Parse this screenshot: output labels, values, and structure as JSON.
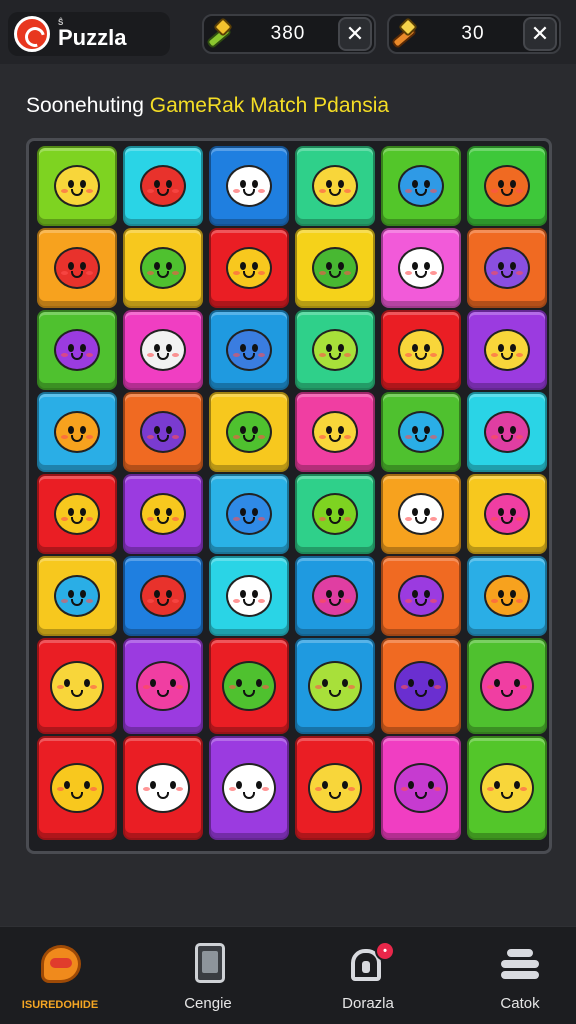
{
  "header": {
    "brand_small": "Ŝ",
    "brand_name": "Puzzla",
    "counters": [
      {
        "value": "380",
        "icon": "hammer-icon",
        "close": "✕"
      },
      {
        "value": "30",
        "icon": "rocket-icon",
        "close": "✕"
      }
    ]
  },
  "title": {
    "part1": "Soonehuting ",
    "part2": "GameRak Match Pdansia"
  },
  "board": {
    "rows": [
      [
        {
          "color": "#7ed321",
          "face": "#f8d63a",
          "icon": "cat-face-icon"
        },
        {
          "color": "#2ad4e6",
          "face": "#e8322c",
          "icon": "rocket-icon"
        },
        {
          "color": "#1f7fe0",
          "face": "#ffffff",
          "icon": "ghost-face-icon"
        },
        {
          "color": "#2fd08a",
          "face": "#f8d63a",
          "icon": "smile-bubble-icon"
        },
        {
          "color": "#53c62a",
          "face": "#2f9ae6",
          "icon": "blob-face-icon"
        },
        {
          "color": "#3ec83a",
          "face": "#f06a22",
          "icon": "chat-face-icon"
        }
      ],
      [
        {
          "color": "#f7a21e",
          "face": "#e8322c",
          "icon": "devil-face-icon"
        },
        {
          "color": "#f7c81e",
          "face": "#4fc12f",
          "icon": "blob-face-icon"
        },
        {
          "color": "#ea1e24",
          "face": "#f8c81e",
          "icon": "sun-face-icon"
        },
        {
          "color": "#f5d21a",
          "face": "#48b832",
          "icon": "blob-face-icon"
        },
        {
          "color": "#f25ad9",
          "face": "#ffffff",
          "icon": "star-face-icon"
        },
        {
          "color": "#f06a22",
          "face": "#8a4fe0",
          "icon": "chat-face-icon"
        }
      ],
      [
        {
          "color": "#4fc12f",
          "face": "#9b3be0",
          "icon": "chat-face-icon"
        },
        {
          "color": "#f03ec2",
          "face": "#f2f2f2",
          "icon": "sword-icon"
        },
        {
          "color": "#1f9ae0",
          "face": "#3a7de0",
          "icon": "planet-icon"
        },
        {
          "color": "#2fd08a",
          "face": "#a8e03a",
          "icon": "blob-face-icon"
        },
        {
          "color": "#ea1e24",
          "face": "#f8d63a",
          "icon": "chat-face-icon"
        },
        {
          "color": "#9b3be0",
          "face": "#f8d63a",
          "icon": "chat-face-icon"
        }
      ],
      [
        {
          "color": "#2aaee6",
          "face": "#f7a21e",
          "icon": "coin-icon"
        },
        {
          "color": "#f06a22",
          "face": "#7a3bd0",
          "icon": "box-icon"
        },
        {
          "color": "#f7c81e",
          "face": "#4fc12f",
          "icon": "blob-face-icon"
        },
        {
          "color": "#f03ea2",
          "face": "#f8d63a",
          "icon": "chat-face-icon"
        },
        {
          "color": "#4fc12f",
          "face": "#2aaee6",
          "icon": "splat-icon"
        },
        {
          "color": "#2ad4e6",
          "face": "#e03ea2",
          "icon": "planet-icon"
        }
      ],
      [
        {
          "color": "#ea1e24",
          "face": "#f7c81e",
          "icon": "heart-shield-icon"
        },
        {
          "color": "#9b3be0",
          "face": "#f7c81e",
          "icon": "rocket-icon"
        },
        {
          "color": "#2ab2e6",
          "face": "#2f8ae6",
          "icon": "blob-face-icon"
        },
        {
          "color": "#2fd08a",
          "face": "#7ed321",
          "icon": "blob-face-icon"
        },
        {
          "color": "#f7a21e",
          "face": "#ffffff",
          "icon": "ghost-face-icon"
        },
        {
          "color": "#f7c81e",
          "face": "#f03ea2",
          "icon": "chat-face-icon"
        }
      ],
      [
        {
          "color": "#f7c81e",
          "face": "#2aaee6",
          "icon": "splat-icon"
        },
        {
          "color": "#1f7fe0",
          "face": "#e8322c",
          "icon": "chat-face-icon"
        },
        {
          "color": "#2ad4e6",
          "face": "#ffffff",
          "icon": "ghost-face-icon"
        },
        {
          "color": "#1f9ae0",
          "face": "#e03ea2",
          "icon": "monster-face-icon"
        },
        {
          "color": "#f06a22",
          "face": "#9b3be0",
          "icon": "planet-icon"
        },
        {
          "color": "#2aaee6",
          "face": "#f7a21e",
          "icon": "gift-icon"
        }
      ],
      [
        {
          "color": "#ea1e24",
          "face": "#f8d63a",
          "icon": "chat-face-icon"
        },
        {
          "color": "#9b3be0",
          "face": "#f03ea2",
          "icon": "rocket-icon"
        },
        {
          "color": "#ea1e24",
          "face": "#4fc12f",
          "icon": "blob-face-icon"
        },
        {
          "color": "#1f9ae0",
          "face": "#a8e03a",
          "icon": "blob-face-icon"
        },
        {
          "color": "#f06a22",
          "face": "#6a2fd0",
          "icon": "owl-face-icon"
        },
        {
          "color": "#4fc12f",
          "face": "#f03ea2",
          "icon": "chat-face-icon"
        }
      ],
      [
        {
          "color": "#ea1e24",
          "face": "#f8c81e",
          "icon": "happy-face-icon"
        },
        {
          "color": "#ea1e24",
          "face": "#ffffff",
          "icon": "cat-face-icon"
        },
        {
          "color": "#9b3be0",
          "face": "#ffffff",
          "icon": "ghost-face-icon"
        },
        {
          "color": "#ea1e24",
          "face": "#f8d63a",
          "icon": "smile-face-icon"
        },
        {
          "color": "#f03ec2",
          "face": "#c63bd0",
          "icon": "monster-face-icon"
        },
        {
          "color": "#53c62a",
          "face": "#f8d63a",
          "icon": "cat-face-icon"
        }
      ]
    ]
  },
  "nav": [
    {
      "label": "ISUREDOHIDE",
      "icon": "home-icon"
    },
    {
      "label": "Cengie",
      "icon": "tablet-icon"
    },
    {
      "label": "Dorazla",
      "icon": "lock-icon",
      "badge": "•"
    },
    {
      "label": "Catok",
      "icon": "stack-icon"
    }
  ]
}
